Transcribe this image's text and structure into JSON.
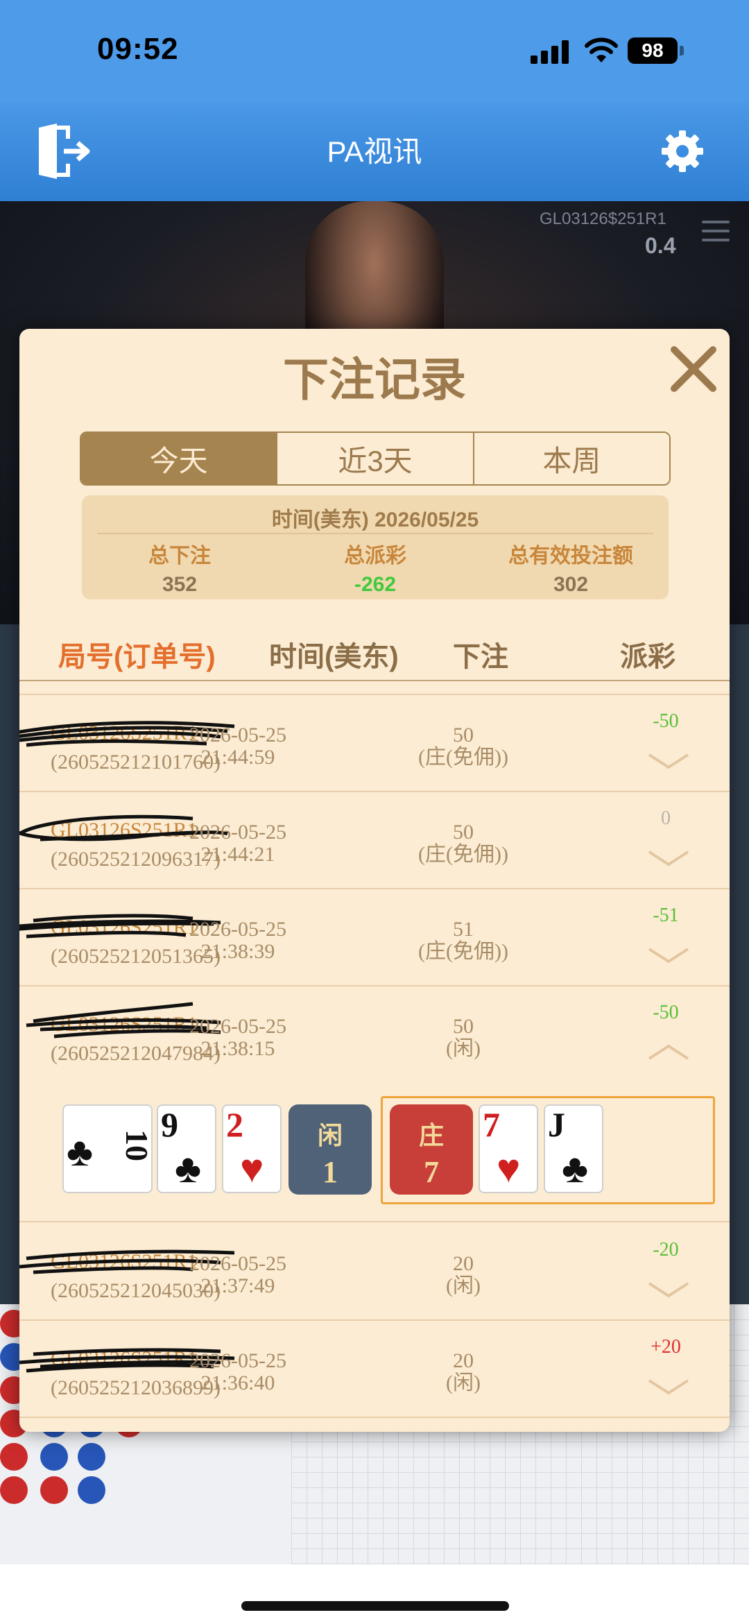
{
  "status_bar": {
    "time": "09:52",
    "battery": "98"
  },
  "header": {
    "title": "PA视讯"
  },
  "background": {
    "table_code": "GL03126$251R1",
    "table_limit": "0.4"
  },
  "modal": {
    "title": "下注记录",
    "tabs": [
      {
        "label": "今天",
        "active": true
      },
      {
        "label": "近3天",
        "active": false
      },
      {
        "label": "本周",
        "active": false
      }
    ],
    "summary": {
      "time": "时间(美东) 2026/05/25",
      "total_bet_label": "总下注",
      "total_bet": "352",
      "total_payout_label": "总派彩",
      "total_payout": "-262",
      "total_valid_label": "总有效投注额",
      "total_valid": "302"
    },
    "columns": {
      "round": "局号(订单号)",
      "time": "时间(美东)",
      "bet": "下注",
      "payout": "派彩"
    },
    "rows": [
      {
        "round": "GL03126S251R1",
        "order": "(260525212101760)",
        "date": "2026-05-25",
        "clock": "21:44:59",
        "amount": "50",
        "bet_type": "(庄(免佣))",
        "payout": "-50",
        "expanded": false
      },
      {
        "round": "GL03126S251R1",
        "order": "(260525212096317)",
        "date": "2026-05-25",
        "clock": "21:44:21",
        "amount": "50",
        "bet_type": "(庄(免佣))",
        "payout": "0",
        "expanded": false
      },
      {
        "round": "GL03126S251R1",
        "order": "(260525212051365)",
        "date": "2026-05-25",
        "clock": "21:38:39",
        "amount": "51",
        "bet_type": "(庄(免佣))",
        "payout": "-51",
        "expanded": false
      },
      {
        "round": "GL03126S251R1",
        "order": "(260525212047984)",
        "date": "2026-05-25",
        "clock": "21:38:15",
        "amount": "50",
        "bet_type": "(闲)",
        "payout": "-50",
        "expanded": true
      },
      {
        "round": "GL03126S251R1",
        "order": "(260525212045030)",
        "date": "2026-05-25",
        "clock": "21:37:49",
        "amount": "20",
        "bet_type": "(闲)",
        "payout": "-20",
        "expanded": false
      },
      {
        "round": "GL03126S251R1",
        "order": "(260525212036899)",
        "date": "2026-05-25",
        "clock": "21:36:40",
        "amount": "20",
        "bet_type": "(闲)",
        "payout": "+20",
        "expanded": false
      }
    ],
    "detail": {
      "player_label": "闲",
      "player_points": "1",
      "banker_label": "庄",
      "banker_points": "7",
      "player_cards": [
        {
          "rank": "10",
          "suit": "♣",
          "color": "black",
          "rotated": true
        },
        {
          "rank": "9",
          "suit": "♣",
          "color": "black"
        },
        {
          "rank": "2",
          "suit": "♥",
          "color": "red"
        }
      ],
      "banker_cards": [
        {
          "rank": "7",
          "suit": "♥",
          "color": "red"
        },
        {
          "rank": "J",
          "suit": "♣",
          "color": "black"
        }
      ]
    }
  },
  "colors": {
    "accent": "#a6844f",
    "modal_bg": "#fbecd3",
    "header_blue": "#3a8de0",
    "payout_negative": "#5abf38",
    "payout_positive": "#e0302e",
    "banker_red": "#c73f38",
    "player_slate": "#4f6278"
  },
  "icons": [
    "exit-icon",
    "gear-icon",
    "close-icon",
    "menu-icon",
    "chevron-down-icon",
    "chevron-up-icon"
  ]
}
